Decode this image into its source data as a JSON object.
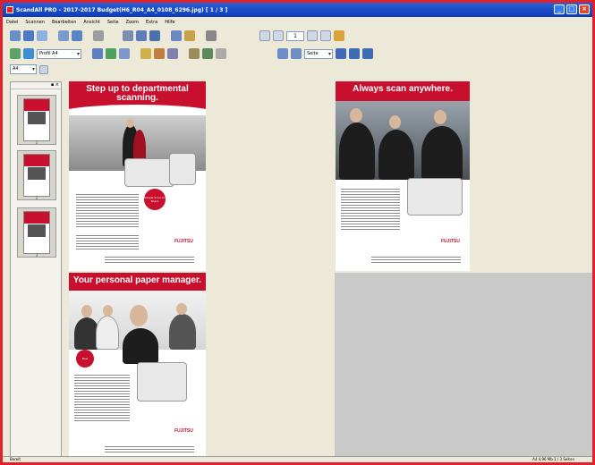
{
  "window": {
    "title": "ScandAll PRO – 2017-2017 Budget(H6_R04_A4_0108_6296.jpg) [ 1 / 3 ]"
  },
  "menu": [
    "Datei",
    "Scannen",
    "Bearbeiten",
    "Ansicht",
    "Seite",
    "Zoom",
    "Extra",
    "Hilfe"
  ],
  "toolbar": {
    "profile_select": "Profil A4",
    "page_number": "1",
    "zoom_select": "Seite"
  },
  "view_select": "A4",
  "sidebar": {
    "thumbnails": [
      "1",
      "2",
      "3"
    ]
  },
  "pages": [
    {
      "headline": "Step up to departmental scanning.",
      "brand": "FUJITSU",
      "badge": "Simple Scan-to-Share"
    },
    {
      "headline": "Always scan anywhere.",
      "brand": "FUJITSU"
    },
    {
      "headline": "Your personal paper manager.",
      "brand": "FUJITSU",
      "badge": "New"
    }
  ],
  "statusbar": {
    "left": "Bereit",
    "right": "A4   4,96 Mb   1 / 3 Seiten"
  },
  "colors": {
    "accent": "#c8102e",
    "frame": "#e0202a",
    "titlebar": "#0a3cb8"
  }
}
